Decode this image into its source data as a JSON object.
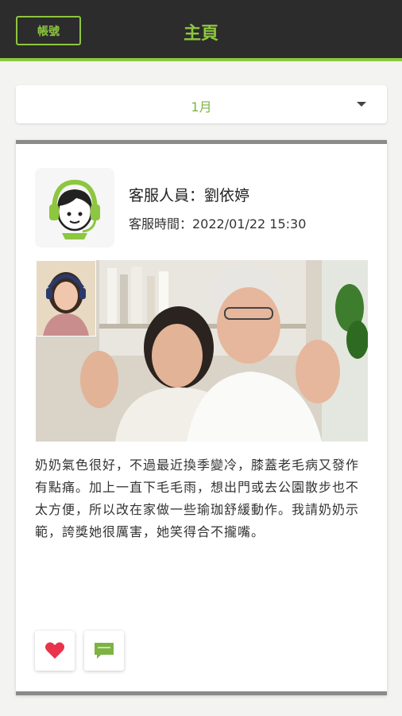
{
  "header": {
    "account_label": "帳號",
    "title": "主頁"
  },
  "month_selector": {
    "selected": "1月",
    "icon": "caret-down-icon"
  },
  "post": {
    "staff_name": "客服人員：劉依婷",
    "service_time": "客服時間：2022/01/22 15:30",
    "avatar_icon": "customer-service-headset-icon",
    "photo_description_icon": "video-call-photo",
    "body": "奶奶氣色很好，不過最近換季變冷，膝蓋老毛病又發作有點痛。加上一直下毛毛雨，想出門或去公園散步也不太方便，所以改在家做一些瑜珈舒緩動作。我請奶奶示範，誇獎她很厲害，她笑得合不攏嘴。",
    "actions": {
      "like_icon": "heart-icon",
      "comment_icon": "comment-icon"
    }
  },
  "colors": {
    "accent": "#8dc63f",
    "topbar": "#2c2c2c",
    "like": "#e8334a",
    "comment": "#7cb342"
  }
}
